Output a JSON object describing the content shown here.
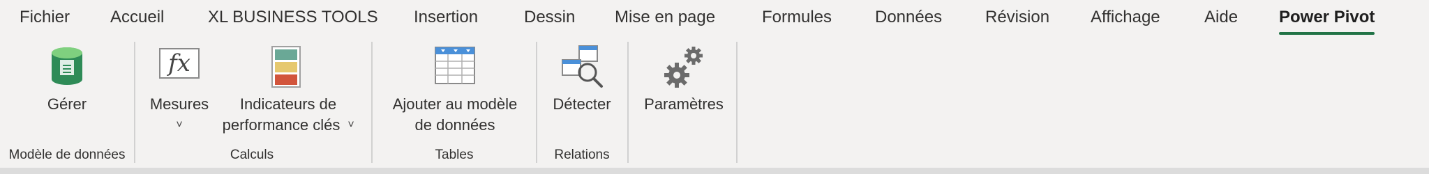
{
  "tabs": [
    "Fichier",
    "Accueil",
    "XL BUSINESS TOOLS",
    "Insertion",
    "Dessin",
    "Mise en page",
    "Formules",
    "Données",
    "Révision",
    "Affichage",
    "Aide",
    "Power Pivot"
  ],
  "ribbon": {
    "gerer": {
      "label": "Gérer",
      "icon": "data-model-cube-icon"
    },
    "mesures": {
      "label": "Mesures",
      "chevron": "˅",
      "icon": "fx-icon"
    },
    "indicateurs": {
      "line1": "Indicateurs de",
      "line2": "performance clés",
      "chevron": "˅",
      "icon": "kpi-icon"
    },
    "ajouter": {
      "line1": "Ajouter au modèle",
      "line2": "de données",
      "icon": "table-add-icon"
    },
    "detecter": {
      "label": "Détecter",
      "icon": "detect-relations-icon"
    },
    "parametres": {
      "label": "Paramètres",
      "icon": "gears-icon"
    },
    "groups": {
      "modele": "Modèle de données",
      "calculs": "Calculs",
      "tables": "Tables",
      "relations": "Relations"
    }
  },
  "colors": {
    "accent": "#217346",
    "kpi_green": "#6aa896",
    "kpi_yellow": "#e6c86e",
    "kpi_red": "#d2553c"
  }
}
